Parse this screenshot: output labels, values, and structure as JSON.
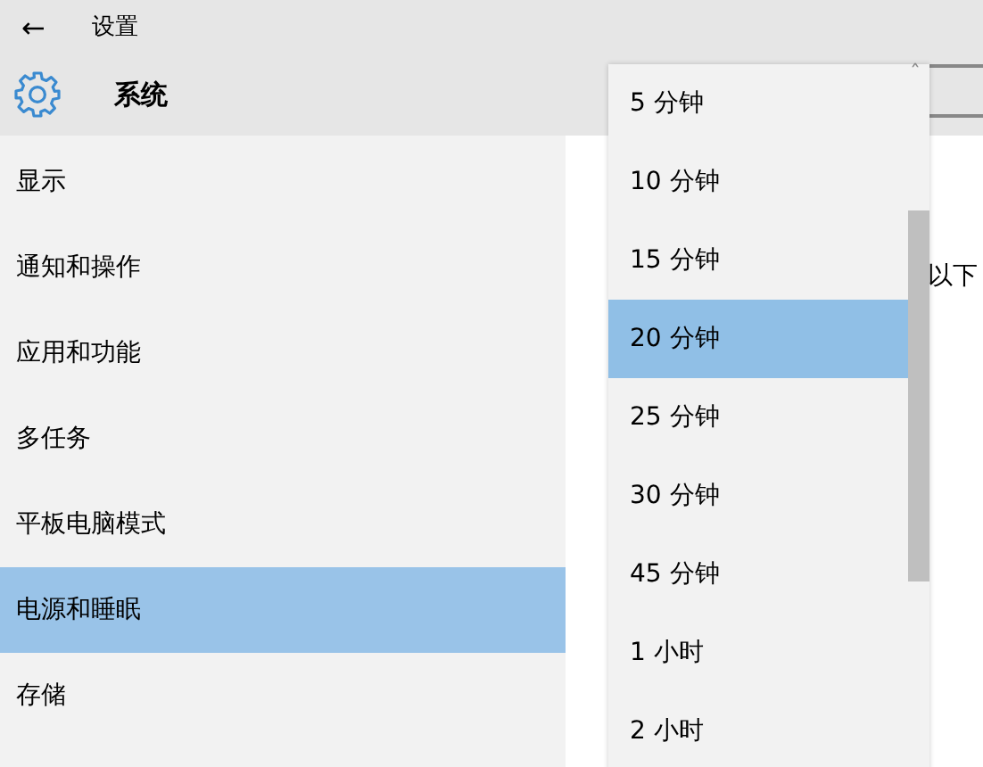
{
  "window": {
    "title": "设置",
    "back": "←"
  },
  "header": {
    "title": "系统"
  },
  "sidebar": {
    "items": [
      {
        "label": "显示",
        "selected": false
      },
      {
        "label": "通知和操作",
        "selected": false
      },
      {
        "label": "应用和功能",
        "selected": false
      },
      {
        "label": "多任务",
        "selected": false
      },
      {
        "label": "平板电脑模式",
        "selected": false
      },
      {
        "label": "电源和睡眠",
        "selected": true
      },
      {
        "label": "存储",
        "selected": false
      }
    ]
  },
  "content": {
    "text": "以下"
  },
  "dropdown": {
    "scroll_up": "ˆ",
    "options": [
      {
        "label": "5 分钟",
        "selected": false
      },
      {
        "label": "10 分钟",
        "selected": false
      },
      {
        "label": "15 分钟",
        "selected": false
      },
      {
        "label": "20 分钟",
        "selected": true
      },
      {
        "label": "25 分钟",
        "selected": false
      },
      {
        "label": "30 分钟",
        "selected": false
      },
      {
        "label": "45 分钟",
        "selected": false
      },
      {
        "label": "1 小时",
        "selected": false
      },
      {
        "label": "2 小时",
        "selected": false
      }
    ]
  }
}
